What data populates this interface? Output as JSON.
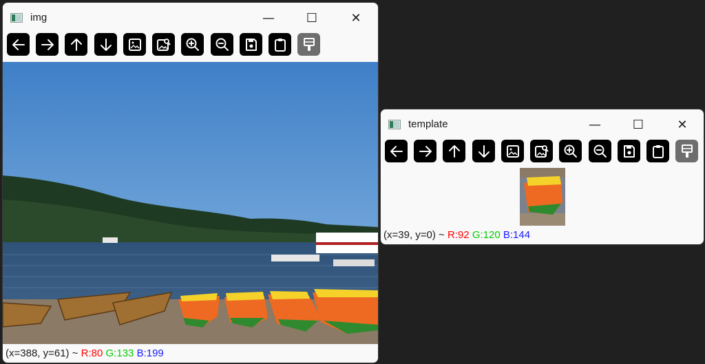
{
  "windows": {
    "img": {
      "title": "img",
      "status": {
        "coords": "(x=388, y=61) ~ ",
        "r": "R:80",
        "g": "G:133",
        "b": "B:199"
      }
    },
    "template": {
      "title": "template",
      "status": {
        "coords": "(x=39, y=0) ~ ",
        "r": "R:92",
        "g": "G:120",
        "b": "B:144"
      }
    }
  },
  "window_controls": {
    "minimize": "—",
    "maximize": "☐",
    "close": "✕"
  },
  "toolbar_icons": [
    "arrow-left-icon",
    "arrow-right-icon",
    "arrow-up-icon",
    "arrow-down-icon",
    "image-icon",
    "image-search-icon",
    "zoom-in-icon",
    "zoom-out-icon",
    "save-icon",
    "clipboard-icon",
    "paint-brush-icon"
  ],
  "colors": {
    "toolbar_button": "#000000",
    "toolbar_button_disabled": "#6e6e6e",
    "status_r": "#ff0000",
    "status_g": "#00cc00",
    "status_b": "#1a1aff",
    "desktop": "#202020"
  }
}
